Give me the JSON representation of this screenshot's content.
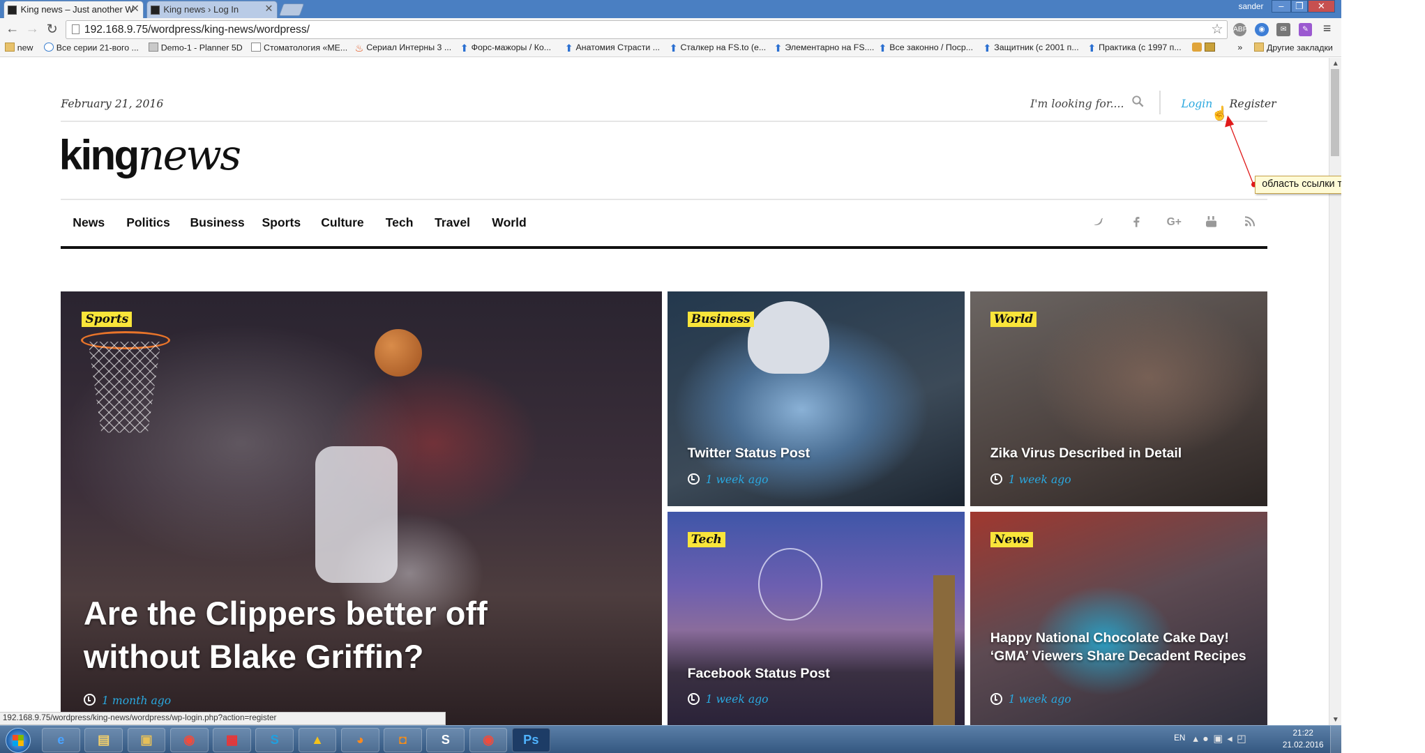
{
  "browser": {
    "tabs": [
      {
        "label": "King news – Just another W",
        "active": true
      },
      {
        "label": "King news › Log In",
        "active": false
      }
    ],
    "user": "sander",
    "url": "192.168.9.75/wordpress/king-news/wordpress/",
    "status_url": "192.168.9.75/wordpress/king-news/wordpress/wp-login.php?action=register"
  },
  "bookmarks": [
    {
      "label": "new",
      "icon": "folder-icon"
    },
    {
      "label": "Все серии 21-вого ...",
      "icon": "spinner-icon"
    },
    {
      "label": "Demo-1 - Planner 5D",
      "icon": "page-icon"
    },
    {
      "label": "Стоматология «МЕ...",
      "icon": "page-icon"
    },
    {
      "label": "Сериал Интерны 3 ...",
      "icon": "flame-icon"
    },
    {
      "label": "Форс-мажоры / Ко...",
      "icon": "arrow-up-icon"
    },
    {
      "label": "Анатомия Страсти ...",
      "icon": "arrow-up-icon"
    },
    {
      "label": "Сталкер на FS.to (е...",
      "icon": "arrow-up-icon"
    },
    {
      "label": "Элементарно на FS....",
      "icon": "arrow-up-icon"
    },
    {
      "label": "Все законно / Поср...",
      "icon": "arrow-up-icon"
    },
    {
      "label": "Защитник (с 2001 п...",
      "icon": "arrow-up-icon"
    },
    {
      "label": "Практика (с 1997 п...",
      "icon": "arrow-up-icon"
    },
    {
      "label": "»",
      "icon": ""
    },
    {
      "label": "Другие закладки",
      "icon": "folder-icon"
    }
  ],
  "site": {
    "date": "February 21, 2016",
    "search_placeholder": "I'm looking for....",
    "login": "Login",
    "register": "Register",
    "logo_part1": "king",
    "logo_part2": "news",
    "nav": [
      "News",
      "Politics",
      "Business",
      "Sports",
      "Culture",
      "Tech",
      "Travel",
      "World"
    ],
    "social": [
      "twitter-icon",
      "facebook-icon",
      "google-plus-icon",
      "youtube-icon",
      "rss-icon"
    ]
  },
  "cards": {
    "main": {
      "category": "Sports",
      "title": "Are the Clippers better off without Blake Griffin?",
      "time": "1 month ago"
    },
    "twitter": {
      "category": "Business",
      "title": "Twitter Status Post",
      "time": "1 week ago"
    },
    "world": {
      "category": "World",
      "title": "Zika Virus Described in Detail",
      "time": "1 week ago"
    },
    "tech": {
      "category": "Tech",
      "title": "Facebook Status Post",
      "time": "1 week ago"
    },
    "news": {
      "category": "News",
      "title": "Happy National Chocolate Cake Day! ‘GMA’ Viewers Share Decadent Recipes",
      "time": "1 week ago"
    }
  },
  "annotation": {
    "tooltip": "область ссылки только текст"
  },
  "taskbar": {
    "lang": "EN",
    "time": "21:22",
    "date": "21.02.2016"
  },
  "colors": {
    "accent": "#2aa8df",
    "category_badge": "#f9e53a",
    "annotation_arrow": "#e01a1a"
  }
}
